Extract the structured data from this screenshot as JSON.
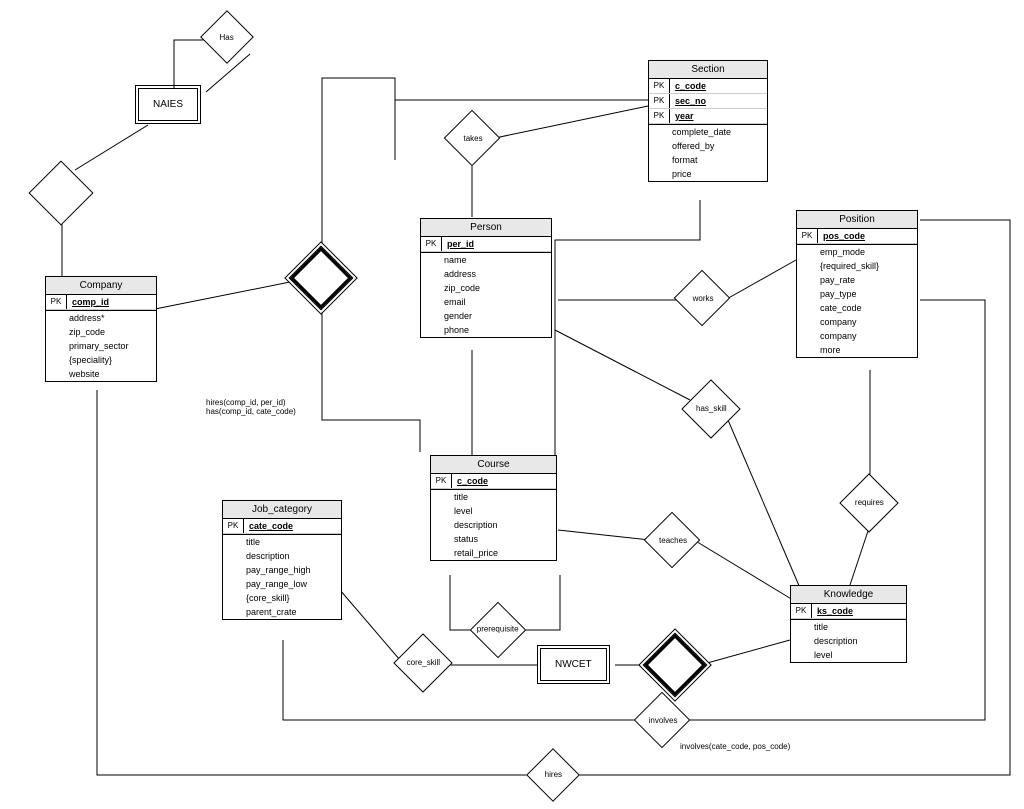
{
  "entities": {
    "section": {
      "title": "Section",
      "pk": [
        "c_code",
        "sec_no",
        "year"
      ],
      "attrs": [
        "complete_date",
        "offered_by",
        "format",
        "price"
      ]
    },
    "person": {
      "title": "Person",
      "pk": [
        "per_id"
      ],
      "attrs": [
        "name",
        "address",
        "zip_code",
        "email",
        "gender",
        "phone"
      ]
    },
    "position": {
      "title": "Position",
      "pk": [
        "pos_code"
      ],
      "attrs": [
        "emp_mode",
        "{required_skill}",
        "pay_rate",
        "pay_type",
        "cate_code",
        "company",
        "company",
        "more"
      ]
    },
    "company": {
      "title": "Company",
      "pk": [
        "comp_id"
      ],
      "attrs": [
        "address*",
        "zip_code",
        "primary_sector",
        "{speciality}",
        "website"
      ]
    },
    "course": {
      "title": "Course",
      "pk": [
        "c_code"
      ],
      "attrs": [
        "title",
        "level",
        "description",
        "status",
        "retail_price"
      ]
    },
    "jobcat": {
      "title": "Job_category",
      "pk": [
        "cate_code"
      ],
      "attrs": [
        "title",
        "description",
        "pay_range_high",
        "pay_range_low",
        "{core_skill}",
        "parent_crate"
      ]
    },
    "knowledge": {
      "title": "Knowledge",
      "pk": [
        "ks_code"
      ],
      "attrs": [
        "title",
        "description",
        "level"
      ]
    }
  },
  "boxes": {
    "naies": "NAIES",
    "nwcet": "NWCET"
  },
  "relationships": {
    "has": "Has",
    "takes": "takes",
    "works": "works",
    "has_skill": "has_skill",
    "requires": "requires",
    "teaches": "teaches",
    "prerequisite": "prerequisite",
    "core_skill": "core_skill",
    "involves": "involves",
    "hires": "hires"
  },
  "annotations": {
    "hires_note": "hires(comp_id, per_id)\nhas(comp_id, cate_code)",
    "involves_note": "involves(cate_code, pos_code)"
  }
}
